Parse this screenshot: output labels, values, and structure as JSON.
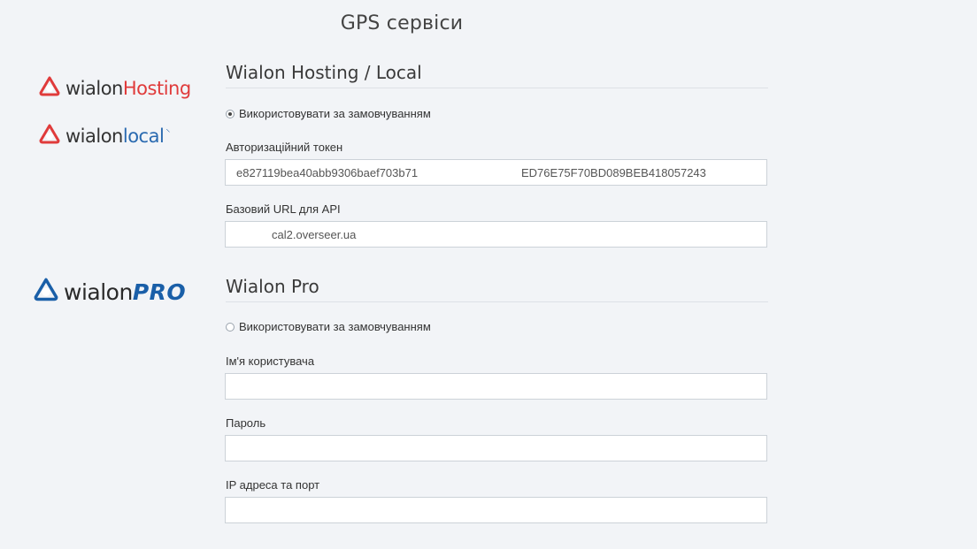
{
  "page": {
    "title": "GPS сервіси"
  },
  "logos": {
    "hosting": {
      "brand": "wialon",
      "suffix": "Hosting",
      "icon": "wialon-logo-icon"
    },
    "local": {
      "brand": "wialon",
      "suffix": "local",
      "icon": "wialon-logo-icon"
    },
    "pro": {
      "brand": "wialon",
      "suffix": "PRO",
      "icon": "wialon-logo-icon"
    }
  },
  "hosting_section": {
    "title": "Wialon Hosting / Local",
    "default_radio_label": "Використовувати за замовчуванням",
    "default_checked": true,
    "token_label": "Авторизаційний токен",
    "token_value_start": "e827119bea40abb9306baef703b71",
    "token_value_end": "ED76E75F70BD089BEB418057243",
    "url_label": "Базовий URL для API",
    "url_value": "cal2.overseer.ua"
  },
  "pro_section": {
    "title": "Wialon Pro",
    "default_radio_label": "Використовувати за замовчуванням",
    "default_checked": false,
    "username_label": "Ім'я користувача",
    "username_value": "",
    "password_label": "Пароль",
    "password_value": "",
    "ip_label": "IP адреса та порт",
    "ip_value": ""
  },
  "colors": {
    "background": "#f2f4f7",
    "hosting_accent": "#e03b3b",
    "local_accent": "#2a6ab0",
    "pro_accent": "#1a5fa8"
  }
}
